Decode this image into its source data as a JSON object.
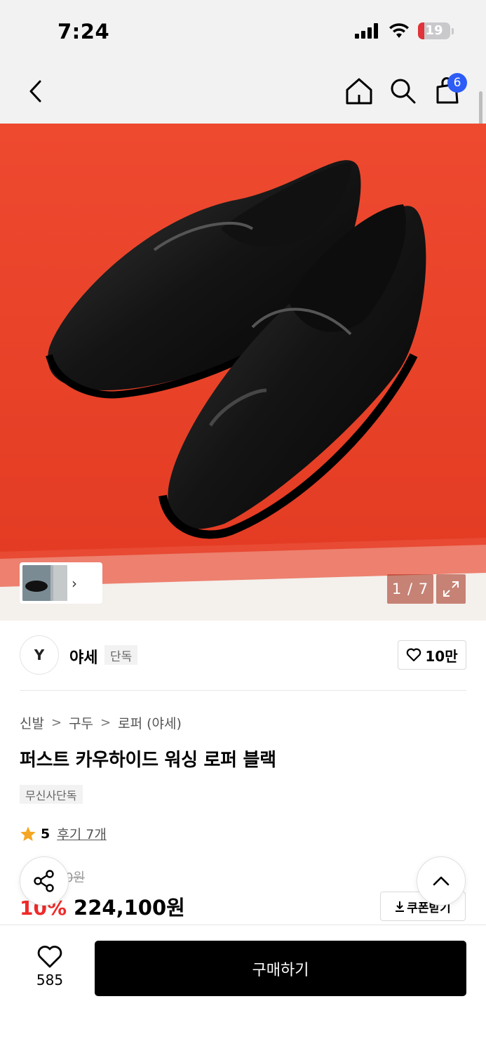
{
  "status_bar": {
    "time": "7:24",
    "battery": "19",
    "battery_level": 0.19
  },
  "nav": {
    "cart_count": "6"
  },
  "gallery": {
    "counter": "1 / 7"
  },
  "brand": {
    "logo_text": "Y",
    "name": "야세",
    "tag": "단독",
    "likes": "10만"
  },
  "breadcrumb": [
    "신발",
    "구두",
    "로퍼 (야세)"
  ],
  "product": {
    "title": "퍼스트 카우하이드 워싱 로퍼 블랙",
    "exclusive_tag": "무신사단독",
    "rating": "5",
    "reviews": "후기 7개",
    "original_price": "249,000원",
    "discount": "10%",
    "sale_price": "224,100원",
    "coupon_label": "쿠폰받기"
  },
  "bottom": {
    "like_count": "585",
    "buy_label": "구매하기"
  },
  "colors": {
    "accent_blue": "#2d5cf6",
    "discount_red": "#ef2a2a",
    "star": "#f5a623",
    "hero_bg": "#e8402a"
  }
}
